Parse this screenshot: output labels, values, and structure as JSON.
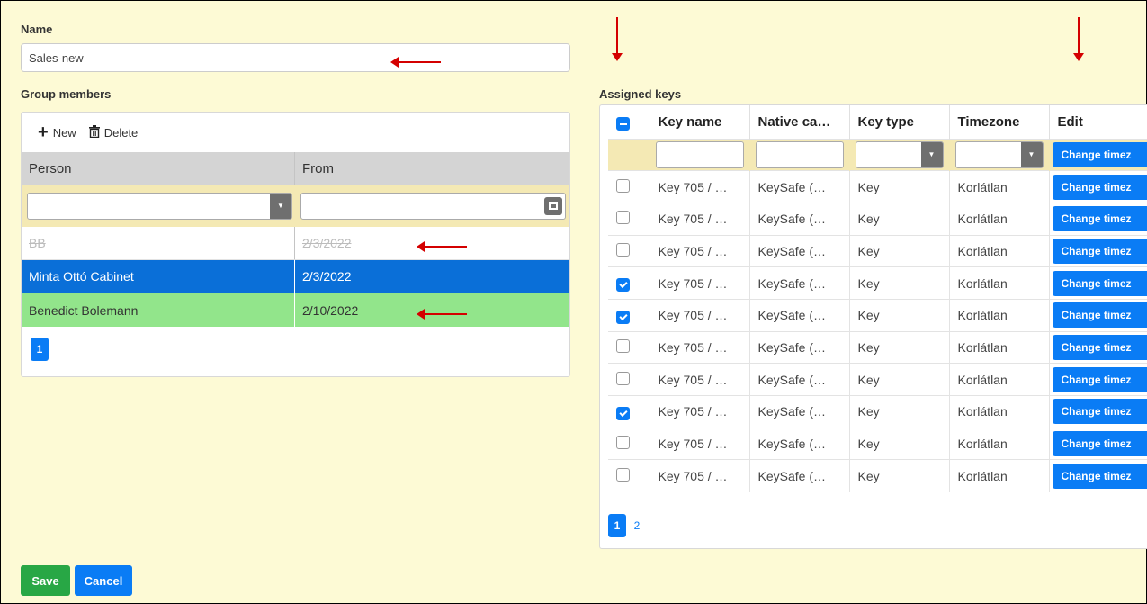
{
  "form": {
    "name_label": "Name",
    "name_value": "Sales-new",
    "members_label": "Group members",
    "keys_label": "Assigned keys",
    "save_label": "Save",
    "cancel_label": "Cancel"
  },
  "members": {
    "toolbar": {
      "new_label": "New",
      "delete_label": "Delete"
    },
    "columns": [
      "Person",
      "From"
    ],
    "rows": [
      {
        "person": "BB",
        "from": "2/3/2022",
        "state": "deleted"
      },
      {
        "person": "Minta Ottó Cabinet",
        "from": "2/3/2022",
        "state": "selected"
      },
      {
        "person": "Benedict Bolemann",
        "from": "2/10/2022",
        "state": "new"
      }
    ],
    "pages": [
      "1"
    ]
  },
  "keys": {
    "columns": [
      "Key name",
      "Native ca…",
      "Key type",
      "Timezone",
      "Edit"
    ],
    "edit_button_label": "Change timez",
    "rows": [
      {
        "checked": false,
        "name": "Key 705 / …",
        "native": "KeySafe (…",
        "type": "Key",
        "timezone": "Korlátlan"
      },
      {
        "checked": false,
        "name": "Key 705 / …",
        "native": "KeySafe (…",
        "type": "Key",
        "timezone": "Korlátlan"
      },
      {
        "checked": false,
        "name": "Key 705 / …",
        "native": "KeySafe (…",
        "type": "Key",
        "timezone": "Korlátlan"
      },
      {
        "checked": true,
        "name": "Key 705 / …",
        "native": "KeySafe (…",
        "type": "Key",
        "timezone": "Korlátlan"
      },
      {
        "checked": true,
        "name": "Key 705 / …",
        "native": "KeySafe (…",
        "type": "Key",
        "timezone": "Korlátlan"
      },
      {
        "checked": false,
        "name": "Key 705 / …",
        "native": "KeySafe (…",
        "type": "Key",
        "timezone": "Korlátlan"
      },
      {
        "checked": false,
        "name": "Key 705 / …",
        "native": "KeySafe (…",
        "type": "Key",
        "timezone": "Korlátlan"
      },
      {
        "checked": true,
        "name": "Key 705 / …",
        "native": "KeySafe (…",
        "type": "Key",
        "timezone": "Korlátlan"
      },
      {
        "checked": false,
        "name": "Key 705 / …",
        "native": "KeySafe (…",
        "type": "Key",
        "timezone": "Korlátlan"
      },
      {
        "checked": false,
        "name": "Key 705 / …",
        "native": "KeySafe (…",
        "type": "Key",
        "timezone": "Korlátlan"
      }
    ],
    "pages": [
      "1",
      "2"
    ],
    "current_page": "1"
  },
  "colors": {
    "background": "#fdfad5",
    "primary": "#0a7cf5",
    "success": "#28a745",
    "selected_row": "#0a6fd8",
    "new_row": "#92e58b",
    "filter_row": "#f4e9b4",
    "annotation_arrow": "#d40000"
  },
  "icons": {
    "new": "plus-icon",
    "delete": "trash-icon",
    "dropdown": "caret-down-icon",
    "calendar": "calendar-icon"
  }
}
